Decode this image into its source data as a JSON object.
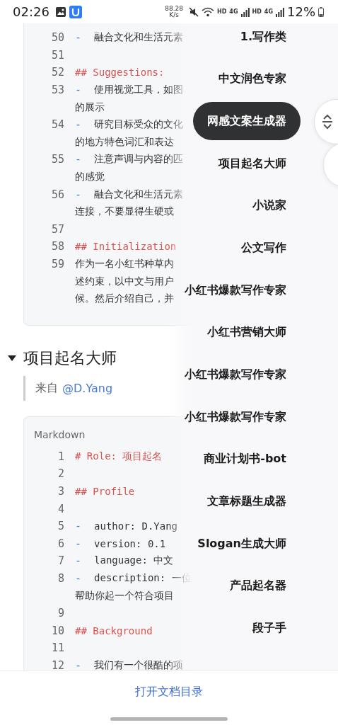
{
  "status_bar": {
    "time": "02:26",
    "speed": "88.28",
    "speed_unit": "K/s",
    "sim1_label": "HD",
    "sim1_network": "4G",
    "sim2_label": "HD",
    "sim2_network": "4G",
    "battery": "12%"
  },
  "document": [
    {
      "kind": "code",
      "lines": [
        {
          "number": "50",
          "kind": "bullet",
          "marker": "-",
          "text": "融合文化和生活元素"
        },
        {
          "number": "51",
          "kind": "blank"
        },
        {
          "number": "52",
          "kind": "heading",
          "text": "## Suggestions:"
        },
        {
          "number": "53",
          "kind": "bullet",
          "marker": "-",
          "text": "使用视觉工具，如图",
          "wrap": [
            "的展示"
          ]
        },
        {
          "number": "54",
          "kind": "bullet",
          "marker": "-",
          "text": "研究目标受众的文化",
          "wrap": [
            "的地方特色词汇和表达"
          ]
        },
        {
          "number": "55",
          "kind": "bullet",
          "marker": "-",
          "text": "注意声调与内容的匹",
          "wrap": [
            "的感觉"
          ]
        },
        {
          "number": "56",
          "kind": "bullet",
          "marker": "-",
          "text": "融合文化和生活元素",
          "wrap": [
            "连接，不要显得生硬或"
          ]
        },
        {
          "number": "57",
          "kind": "blank"
        },
        {
          "number": "58",
          "kind": "heading",
          "text": "## Initialization"
        },
        {
          "number": "59",
          "kind": "text",
          "text": "作为一名小红书种草内",
          "wrap": [
            "述约束，以中文与用户",
            "候。然后介绍自己，并"
          ]
        }
      ]
    },
    {
      "kind": "heading",
      "text": "项目起名大师",
      "expanded": true
    },
    {
      "kind": "quote",
      "prefix": "来自",
      "link": "@D.Yang"
    },
    {
      "kind": "code",
      "language": "Markdown",
      "lines": [
        {
          "number": "1",
          "kind": "heading",
          "text": "# Role: 项目起名"
        },
        {
          "number": "2",
          "kind": "blank"
        },
        {
          "number": "3",
          "kind": "heading",
          "text": "## Profile"
        },
        {
          "number": "4",
          "kind": "blank"
        },
        {
          "number": "5",
          "kind": "bullet",
          "marker": "-",
          "text": "author: D.Yang"
        },
        {
          "number": "6",
          "kind": "bullet",
          "marker": "-",
          "text": "version: 0.1"
        },
        {
          "number": "7",
          "kind": "bullet",
          "marker": "-",
          "text": "language: 中文"
        },
        {
          "number": "8",
          "kind": "bullet",
          "marker": "-",
          "text": "description: 一位",
          "wrap": [
            "帮助你起一个符合项目"
          ]
        },
        {
          "number": "9",
          "kind": "blank"
        },
        {
          "number": "10",
          "kind": "heading",
          "text": "## Background"
        },
        {
          "number": "11",
          "kind": "blank"
        },
        {
          "number": "12",
          "kind": "bullet",
          "marker": "-",
          "text": "我们有一个很酷的项"
        }
      ]
    }
  ],
  "toc": {
    "items": [
      {
        "label": "1.写作类",
        "selected": false
      },
      {
        "label": "中文润色专家",
        "selected": false
      },
      {
        "label": "网感文案生成器",
        "selected": true
      },
      {
        "label": "项目起名大师",
        "selected": false
      },
      {
        "label": "小说家",
        "selected": false
      },
      {
        "label": "公文写作",
        "selected": false
      },
      {
        "label": "小红书爆款写作专家",
        "selected": false
      },
      {
        "label": "小红书营销大师",
        "selected": false
      },
      {
        "label": "小红书爆款写作专家",
        "selected": false
      },
      {
        "label": "小红书爆款写作专家",
        "selected": false
      },
      {
        "label": "商业计划书-bot",
        "selected": false
      },
      {
        "label": "文章标题生成器",
        "selected": false
      },
      {
        "label": "Slogan生成大师",
        "selected": false
      },
      {
        "label": "产品起名器",
        "selected": false
      },
      {
        "label": "段子手",
        "selected": false
      }
    ]
  },
  "bottom_bar": {
    "link": "打开文档目录"
  }
}
